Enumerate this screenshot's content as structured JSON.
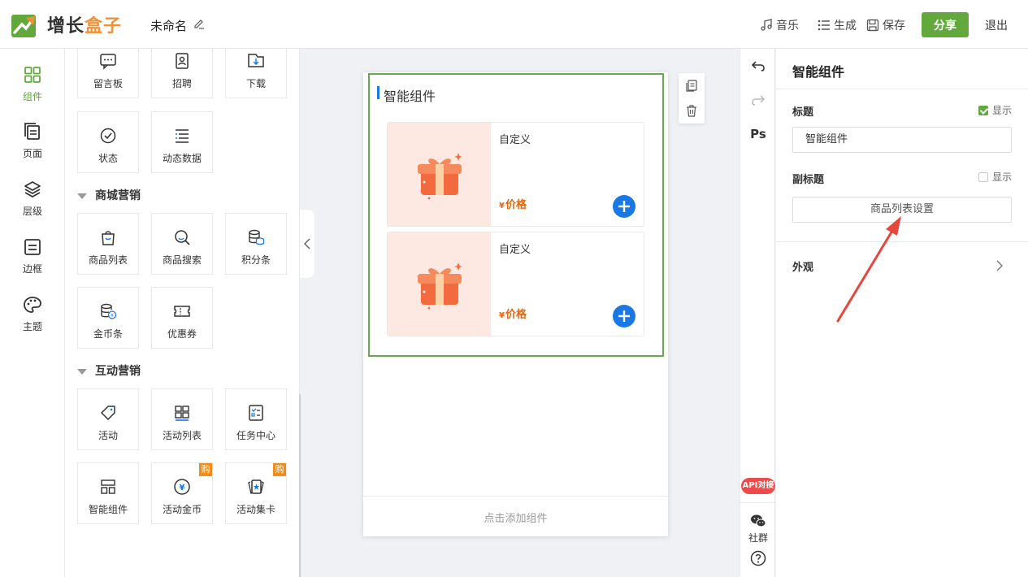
{
  "header": {
    "logo_prefix": "增长",
    "logo_accent": "盒子",
    "doc_title": "未命名",
    "actions": {
      "music": "音乐",
      "generate": "生成",
      "save": "保存"
    },
    "share": "分享",
    "exit": "退出"
  },
  "nav": {
    "components": "组件",
    "pages": "页面",
    "layers": "层级",
    "border": "边框",
    "theme": "主题"
  },
  "panel": {
    "top_tiles": [
      "留言板",
      "招聘",
      "下载"
    ],
    "row2_tiles": [
      "状态",
      "动态数据"
    ],
    "section_mall": "商城营销",
    "mall_row1": [
      "商品列表",
      "商品搜索",
      "积分条"
    ],
    "mall_row2": [
      "金币条",
      "优惠券"
    ],
    "section_interact": "互动营销",
    "interact_row1": [
      "活动",
      "活动列表",
      "任务中心"
    ],
    "interact_row2": [
      "智能组件",
      "活动金币",
      "活动集卡"
    ],
    "buy_badge": "购"
  },
  "canvas": {
    "widget_title": "智能组件",
    "cards": [
      {
        "name": "自定义",
        "currency": "¥",
        "price": "价格"
      },
      {
        "name": "自定义",
        "currency": "¥",
        "price": "价格"
      }
    ],
    "add_component": "点击添加组件"
  },
  "toolstrip": {
    "ps": "Ps",
    "api": "API对接",
    "social": "社群"
  },
  "props": {
    "title": "智能组件",
    "label_title": "标题",
    "show_label": "显示",
    "title_value": "智能组件",
    "label_subtitle": "副标题",
    "product_list_settings": "商品列表设置",
    "appearance": "外观"
  },
  "colors": {
    "brand_green": "#63a83d",
    "accent_orange": "#f29134",
    "primary_blue": "#1a78e5",
    "price_orange": "#e8640c",
    "annotation_red": "#e8453c"
  }
}
